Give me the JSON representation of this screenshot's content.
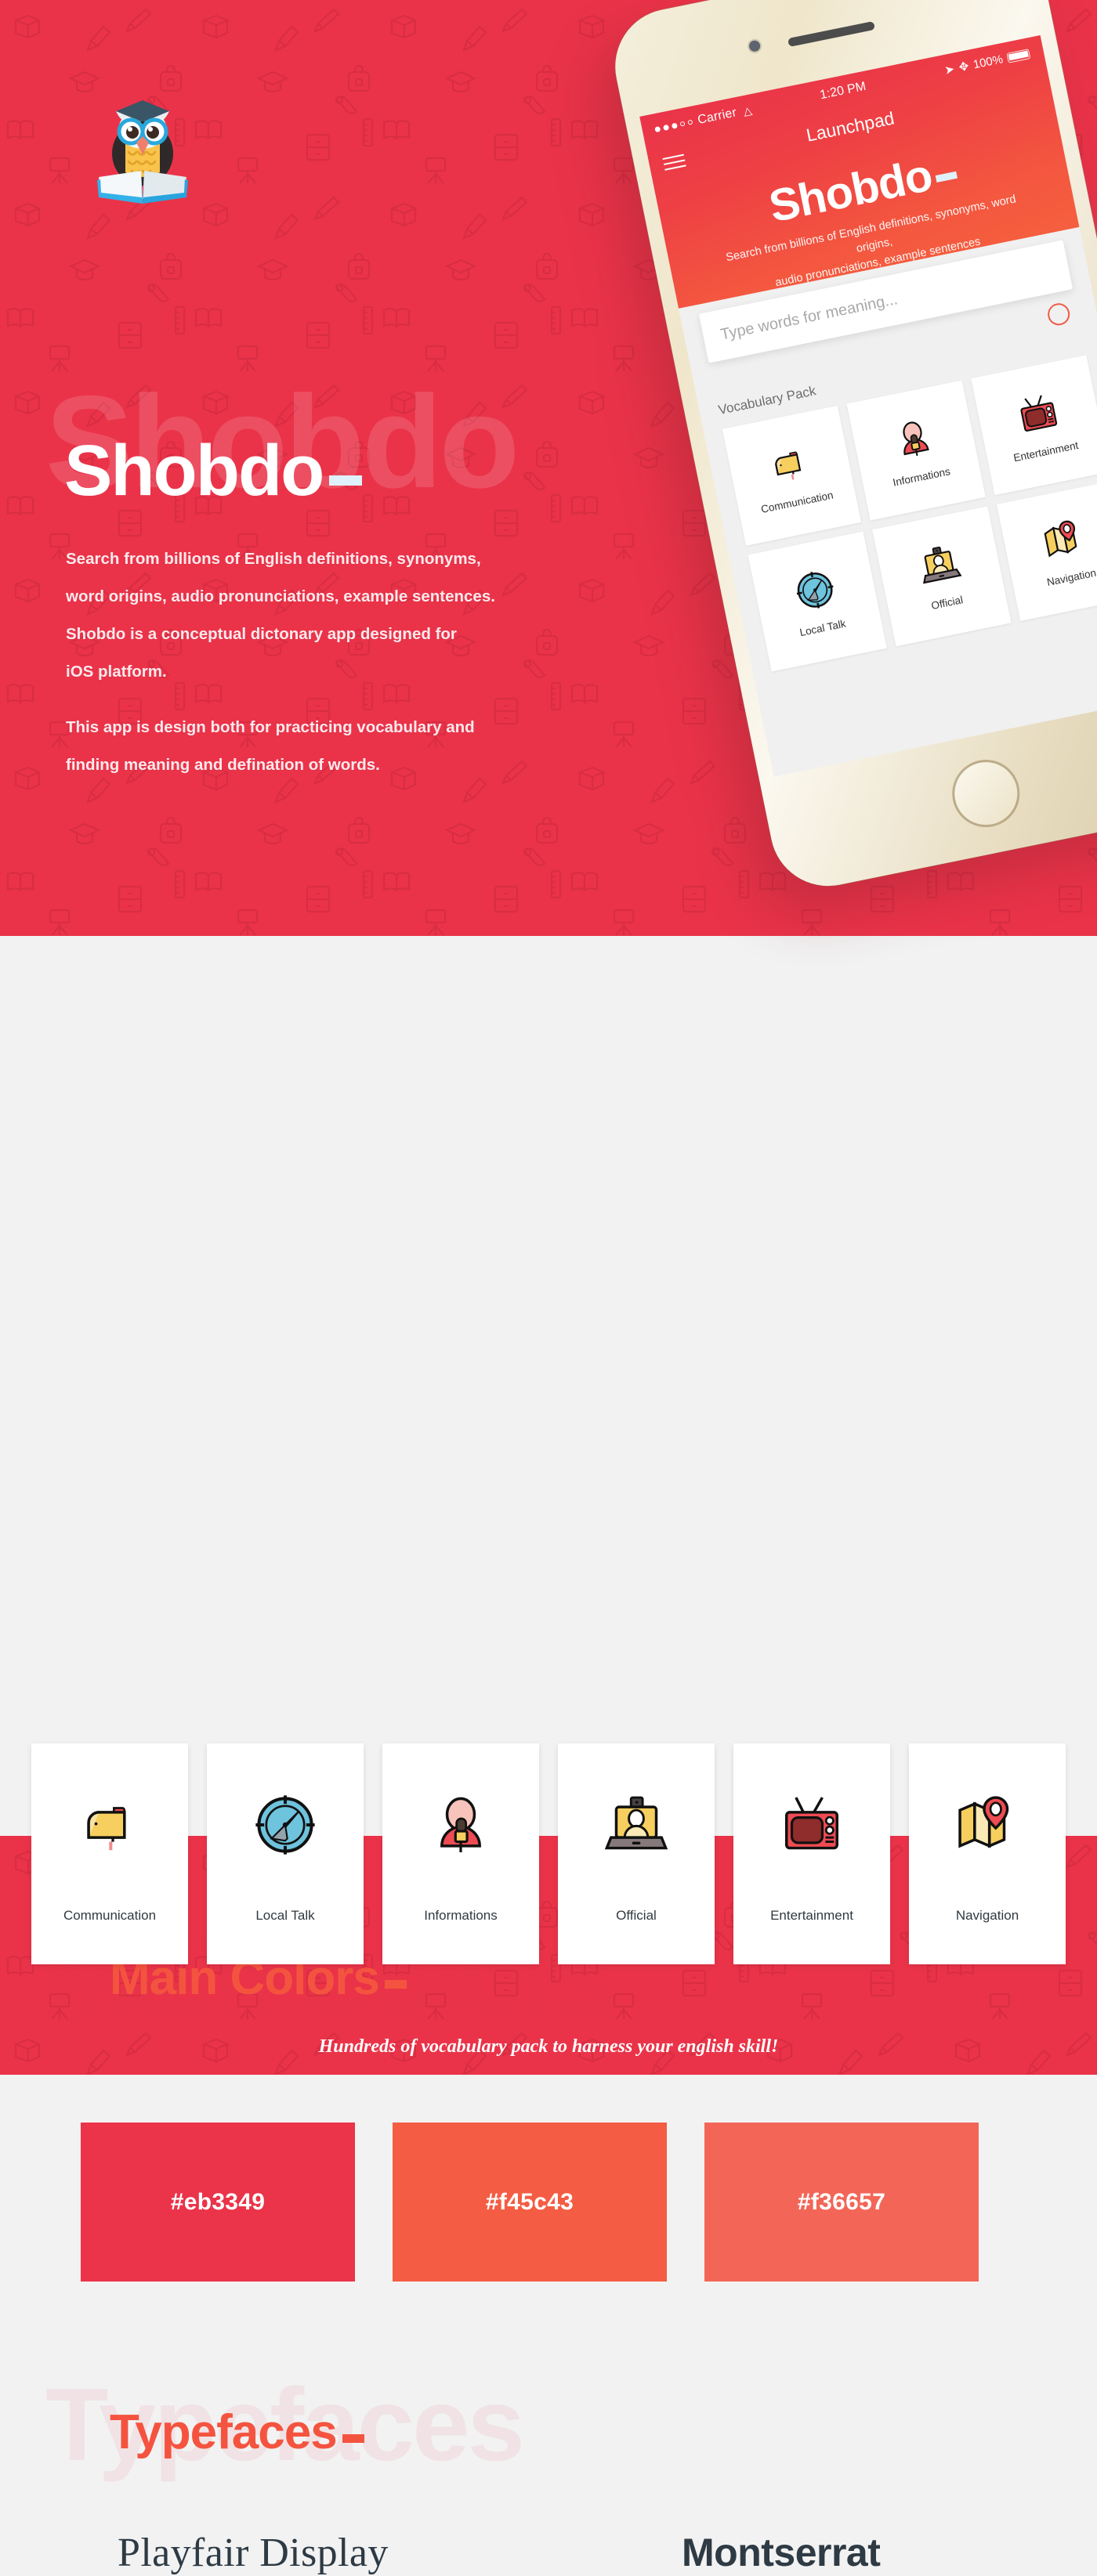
{
  "hero": {
    "brand": "Shobdo",
    "ghost_brand": "Shobdo",
    "paragraph1_lines": [
      "Search from billions of English definitions, synonyms,",
      "word origins, audio pronunciations, example sentences.",
      "Shobdo is a conceptual dictonary app designed for",
      "iOS platform."
    ],
    "paragraph2_lines": [
      "This app is design both for practicing vocabulary and",
      "finding meaning and defination of words."
    ],
    "logo_icon": "owl-graduate-book-icon",
    "background_color": "#ea3349"
  },
  "phone": {
    "status": {
      "carrier": "Carrier",
      "time": "1:20 PM",
      "battery": "100%",
      "wifi_icon": "wifi-icon",
      "bluetooth_icon": "bluetooth-icon",
      "location_icon": "location-arrow-icon"
    },
    "nav": {
      "menu_icon": "hamburger-menu-icon",
      "title": "Launchpad"
    },
    "brand": "Shobdo",
    "subtitle_lines": [
      "Search from billions of English definitions, synonyms, word origins,",
      "audio pronunciations, example sentences"
    ],
    "search_placeholder": "Type words for meaning...",
    "mic_icon": "microphone-icon",
    "vocab_label": "Vocabulary Pack",
    "cells": [
      {
        "label": "Communication",
        "icon": "mailbox-icon"
      },
      {
        "label": "Informations",
        "icon": "reporter-microphone-icon"
      },
      {
        "label": "Entertainment",
        "icon": "television-icon"
      },
      {
        "label": "Local Talk",
        "icon": "compass-icon"
      },
      {
        "label": "Official",
        "icon": "laptop-profile-icon"
      },
      {
        "label": "Navigation",
        "icon": "map-pin-icon"
      }
    ]
  },
  "colors_section": {
    "title": "Main Colors",
    "ghost": "Main Colors",
    "swatches": [
      {
        "hex": "#eb3349",
        "label": "#eb3349"
      },
      {
        "hex": "#f45c43",
        "label": "#f45c43"
      },
      {
        "hex": "#f36657",
        "label": "#f36657"
      }
    ]
  },
  "typefaces_section": {
    "title": "Typefaces",
    "ghost": "Typefaces",
    "faces": [
      {
        "name": "Playfair Display",
        "style": "serif"
      },
      {
        "name": "Montserrat",
        "style": "sans"
      }
    ]
  },
  "cards_strip": {
    "cards": [
      {
        "label": "Communication",
        "icon": "mailbox-icon"
      },
      {
        "label": "Local Talk",
        "icon": "compass-icon"
      },
      {
        "label": "Informations",
        "icon": "reporter-microphone-icon"
      },
      {
        "label": "Official",
        "icon": "laptop-profile-icon"
      },
      {
        "label": "Entertainment",
        "icon": "television-icon"
      },
      {
        "label": "Navigation",
        "icon": "map-pin-icon"
      }
    ],
    "footer_text": "Hundreds of vocabulary pack to harness your english skill!"
  }
}
